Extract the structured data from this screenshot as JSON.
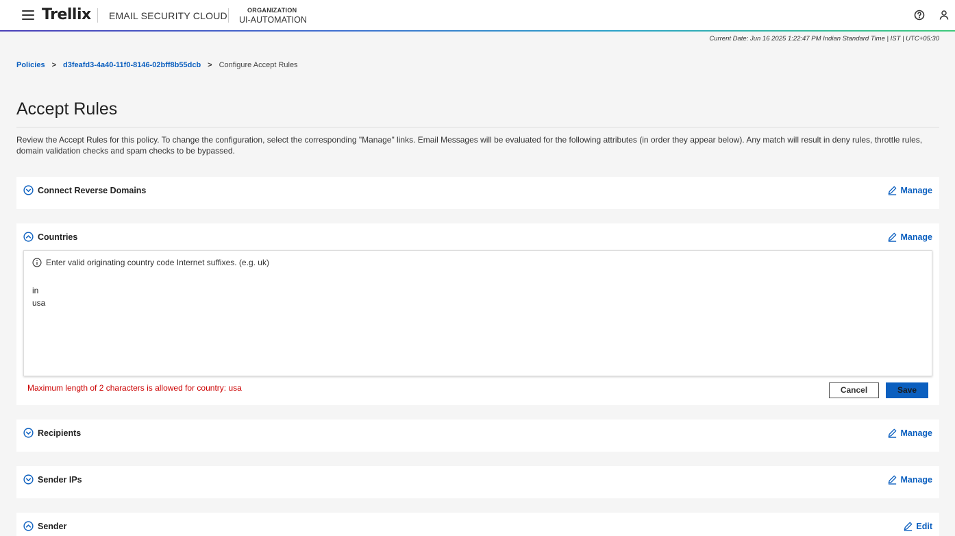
{
  "header": {
    "logo": "Trellix",
    "product": "EMAIL SECURITY CLOUD",
    "org_label": "ORGANIZATION",
    "org_name": "UI-AUTOMATION"
  },
  "current_date": "Current Date: Jun 16 2025 1:22:47 PM Indian Standard Time | IST | UTC+05:30",
  "breadcrumb": {
    "policies": "Policies",
    "policy_id": "d3feafd3-4a40-11f0-8146-02bff8b55dcb",
    "separator": ">",
    "current": "Configure Accept Rules"
  },
  "page": {
    "title": "Accept Rules",
    "description": "Review the Accept Rules for this policy. To change the configuration, select the corresponding \"Manage\" links. Email Messages will be evaluated for the following attributes (in order they appear below). Any match will result in deny rules, throttle rules, domain validation checks and spam checks to be bypassed."
  },
  "sections": {
    "connect_reverse_domains": {
      "title": "Connect Reverse Domains",
      "action": "Manage"
    },
    "countries": {
      "title": "Countries",
      "action": "Manage",
      "hint": "Enter valid originating country code Internet suffixes. (e.g. uk)",
      "value": "in\nusa",
      "error": "Maximum length of 2 characters is allowed for country: usa",
      "cancel_label": "Cancel",
      "save_label": "Save"
    },
    "recipients": {
      "title": "Recipients",
      "action": "Manage"
    },
    "sender_ips": {
      "title": "Sender IPs",
      "action": "Manage"
    },
    "sender": {
      "title": "Sender",
      "action": "Edit"
    }
  },
  "colors": {
    "link": "#0b5fbf",
    "error": "#cc0000",
    "primary_button": "#0b5fbf"
  },
  "icons": [
    "menu-icon",
    "help-icon",
    "user-icon",
    "chevron-down-icon",
    "chevron-up-icon",
    "pencil-icon",
    "info-icon"
  ]
}
